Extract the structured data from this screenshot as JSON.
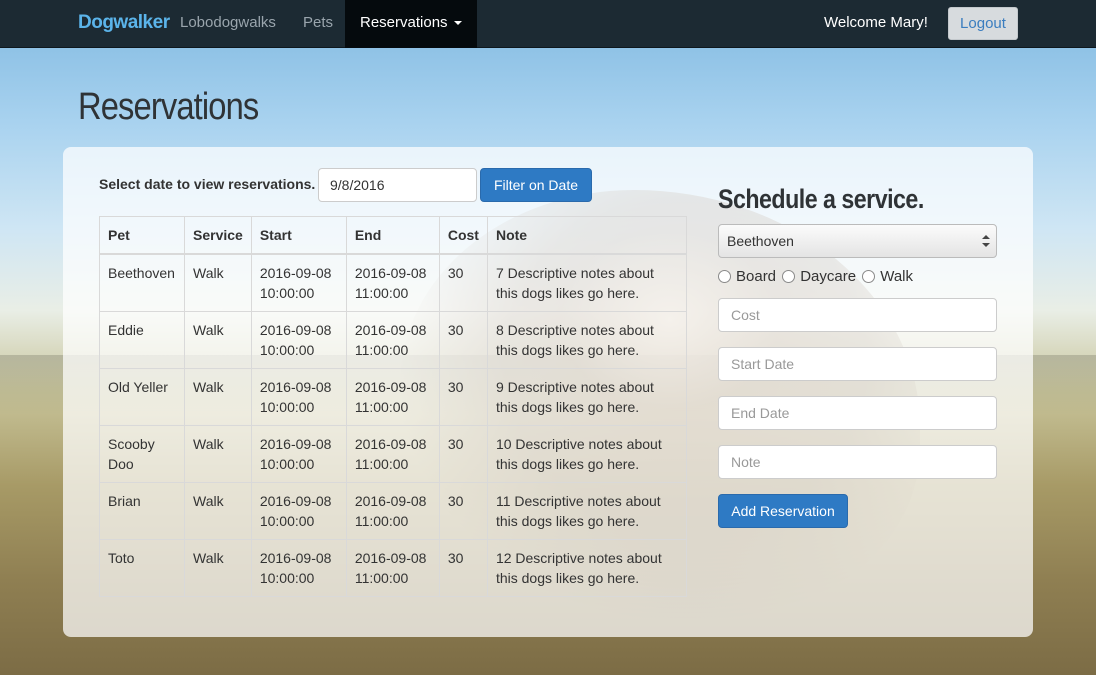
{
  "navbar": {
    "brand": "Dogwalker",
    "links": [
      "Lobodogwalks",
      "Pets"
    ],
    "active_dropdown": "Reservations",
    "welcome": "Welcome Mary!",
    "logout": "Logout"
  },
  "page": {
    "title": "Reservations"
  },
  "filter": {
    "label": "Select date to view reservations.",
    "date_value": "9/8/2016",
    "button": "Filter on Date"
  },
  "table": {
    "headers": [
      "Pet",
      "Service",
      "Start",
      "End",
      "Cost",
      "Note"
    ],
    "rows": [
      [
        "Beethoven",
        "Walk",
        "2016-09-08 10:00:00",
        "2016-09-08 11:00:00",
        "30",
        "7 Descriptive notes about this dogs likes go here."
      ],
      [
        "Eddie",
        "Walk",
        "2016-09-08 10:00:00",
        "2016-09-08 11:00:00",
        "30",
        "8 Descriptive notes about this dogs likes go here."
      ],
      [
        "Old Yeller",
        "Walk",
        "2016-09-08 10:00:00",
        "2016-09-08 11:00:00",
        "30",
        "9 Descriptive notes about this dogs likes go here."
      ],
      [
        "Scooby Doo",
        "Walk",
        "2016-09-08 10:00:00",
        "2016-09-08 11:00:00",
        "30",
        "10 Descriptive notes about this dogs likes go here."
      ],
      [
        "Brian",
        "Walk",
        "2016-09-08 10:00:00",
        "2016-09-08 11:00:00",
        "30",
        "11 Descriptive notes about this dogs likes go here."
      ],
      [
        "Toto",
        "Walk",
        "2016-09-08 10:00:00",
        "2016-09-08 11:00:00",
        "30",
        "12 Descriptive notes about this dogs likes go here."
      ]
    ]
  },
  "schedule": {
    "title": "Schedule a service.",
    "pet_selected": "Beethoven",
    "services": [
      "Board",
      "Daycare",
      "Walk"
    ],
    "cost_placeholder": "Cost",
    "start_placeholder": "Start Date",
    "end_placeholder": "End Date",
    "note_placeholder": "Note",
    "submit": "Add Reservation"
  },
  "colors": {
    "navbar": "#1c2a33",
    "brand": "#5bb4ea",
    "primary_button": "#2e7ac4"
  }
}
